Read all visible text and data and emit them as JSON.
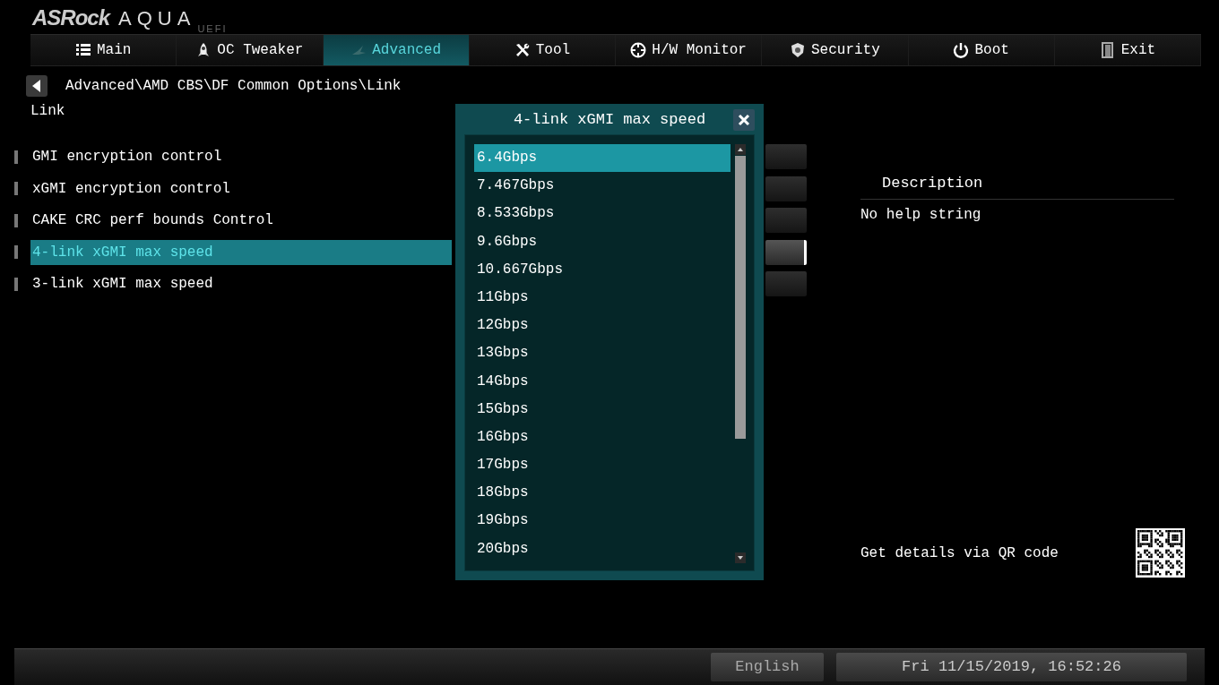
{
  "logo": {
    "brand": "ASRock",
    "product": "AQUA",
    "edition": "UEFI"
  },
  "tabs": [
    {
      "label": "Main",
      "selected": false
    },
    {
      "label": "OC Tweaker",
      "selected": false
    },
    {
      "label": "Advanced",
      "selected": true
    },
    {
      "label": "Tool",
      "selected": false
    },
    {
      "label": "H/W Monitor",
      "selected": false
    },
    {
      "label": "Security",
      "selected": false
    },
    {
      "label": "Boot",
      "selected": false
    },
    {
      "label": "Exit",
      "selected": false
    }
  ],
  "breadcrumb": "Advanced\\AMD CBS\\DF Common Options\\Link",
  "page_title": "Link",
  "settings": [
    {
      "label": "GMI encryption control",
      "selected": false
    },
    {
      "label": "xGMI encryption control",
      "selected": false
    },
    {
      "label": "CAKE CRC perf bounds Control",
      "selected": false
    },
    {
      "label": "4-link xGMI max speed",
      "selected": true
    },
    {
      "label": "3-link xGMI max speed",
      "selected": false
    }
  ],
  "popup": {
    "title": "4-link xGMI max speed",
    "options": [
      {
        "label": "6.4Gbps",
        "selected": true
      },
      {
        "label": "7.467Gbps",
        "selected": false
      },
      {
        "label": "8.533Gbps",
        "selected": false
      },
      {
        "label": "9.6Gbps",
        "selected": false
      },
      {
        "label": "10.667Gbps",
        "selected": false
      },
      {
        "label": "11Gbps",
        "selected": false
      },
      {
        "label": "12Gbps",
        "selected": false
      },
      {
        "label": "13Gbps",
        "selected": false
      },
      {
        "label": "14Gbps",
        "selected": false
      },
      {
        "label": "15Gbps",
        "selected": false
      },
      {
        "label": "16Gbps",
        "selected": false
      },
      {
        "label": "17Gbps",
        "selected": false
      },
      {
        "label": "18Gbps",
        "selected": false
      },
      {
        "label": "19Gbps",
        "selected": false
      },
      {
        "label": "20Gbps",
        "selected": false
      }
    ]
  },
  "description": {
    "heading": "Description",
    "text": "No help string",
    "qr_label": "Get details via QR code"
  },
  "status_bar": {
    "language": "English",
    "datetime": "Fri 11/15/2019, 16:52:26"
  }
}
